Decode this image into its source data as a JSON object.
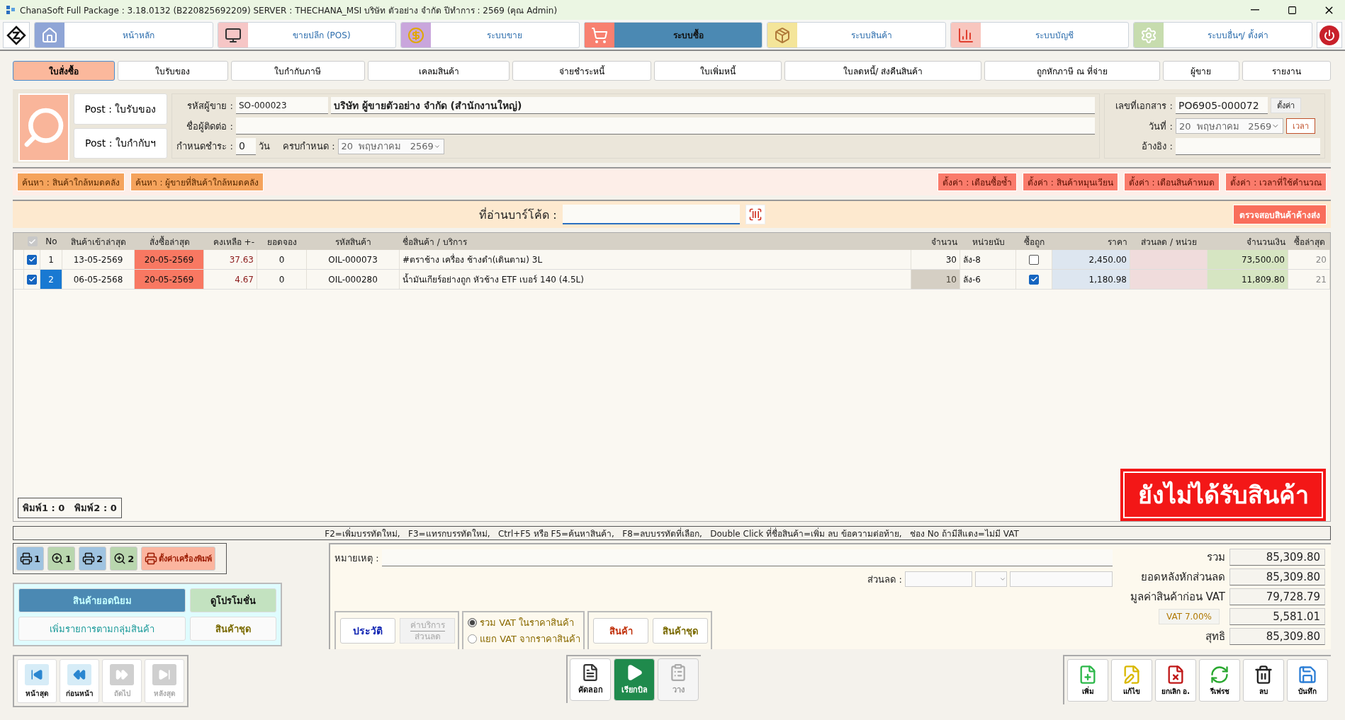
{
  "window": {
    "title": "ChanaSoft Full Package : 3.18.0132 (B220825692209) SERVER : THECHANA_MSI บริษัท ตัวอย่าง จำกัด ปีทำการ : 2569 (คุณ Admin)"
  },
  "modules": [
    {
      "label": "หน้าหลัก",
      "selected": false
    },
    {
      "label": "ขายปลีก (POS)",
      "selected": false
    },
    {
      "label": "ระบบขาย",
      "selected": false
    },
    {
      "label": "ระบบซื้อ",
      "selected": true
    },
    {
      "label": "ระบบสินค้า",
      "selected": false
    },
    {
      "label": "ระบบบัญชี",
      "selected": false
    },
    {
      "label": "ระบบอื่นๆ/ ตั้งค่า",
      "selected": false
    }
  ],
  "doc_tabs": [
    {
      "label": "ใบสั่งซื้อ",
      "selected": true
    },
    {
      "label": "ใบรับของ",
      "selected": false
    },
    {
      "label": "ใบกำกับภาษี",
      "selected": false
    },
    {
      "label": "เคลมสินค้า",
      "selected": false
    },
    {
      "label": "จ่ายชำระหนี้",
      "selected": false
    },
    {
      "label": "ใบเพิ่มหนี้",
      "selected": false
    },
    {
      "label": "ใบลดหนี้/ ส่งคืนสินค้า",
      "selected": false
    },
    {
      "label": "ถูกหักภาษี ณ ที่จ่าย",
      "selected": false
    },
    {
      "label": "ผู้ขาย",
      "selected": false
    },
    {
      "label": "รายงาน",
      "selected": false
    }
  ],
  "post_buttons": [
    "Post : ใบรับของ",
    "Post : ใบกำกับฯ"
  ],
  "supplier": {
    "code_label": "รหัสผู้ขาย :",
    "code": "SO-000023",
    "name": "บริษัท ผู้ขายตัวอย่าง จำกัด (สำนักงานใหญ่)",
    "contact_label": "ชื่อผู้ติดต่อ :",
    "terms_label": "กำหนดชำระ :",
    "terms": "0",
    "terms_unit": "วัน",
    "due_label": "ครบกำหนด :",
    "due_date": "20  พฤษภาคม   2569"
  },
  "document": {
    "number_label": "เลขที่เอกสาร :",
    "number": "PO6905-000072",
    "setting_button": "ตั้งค่า",
    "date_label": "วันที่ :",
    "date": "20  พฤษภาคม   2569",
    "time_button": "เวลา",
    "reference_label": "อ้างอิง :"
  },
  "search_buttons": [
    "ค้นหา : สินค้าใกล้หมดคลัง",
    "ค้นหา : ผู้ขายที่สินค้าใกล้หมดคลัง"
  ],
  "setting_buttons": [
    "ตั้งค่า : เตือนซื้อซ้ำ",
    "ตั้งค่า : สินค้าหมุนเวียน",
    "ตั้งค่า : เตือนสินค้าหมด",
    "ตั้งค่า : เวลาที่ใช้คำนวณ"
  ],
  "barcode": {
    "label": "ที่อ่านบาร์โค้ด :",
    "check_button": "ตรวจสอบสินค้าค้างส่ง"
  },
  "table": {
    "header_checked": true,
    "columns": [
      "No",
      "สินค้าเข้าล่าสุด",
      "สั่งซื้อล่าสุด",
      "คงเหลือ +-",
      "ยอดจอง",
      "รหัสสินค้า",
      "ชื่อสินค้า / บริการ",
      "จำนวน",
      "หน่วยนับ",
      "ซื้อถูก",
      "ราคา",
      "ส่วนลด / หน่วย",
      "จำนวนเงิน",
      "ซื้อล่าสุด"
    ],
    "rows": [
      {
        "checked": true,
        "selected": false,
        "no": "1",
        "last_in": "13-05-2569",
        "last_order": "20-05-2569",
        "balance": "37.63",
        "reserved": "0",
        "code": "OIL-000073",
        "name": "#ตราช้าง เครื่อง ช้างดำ(เดินตาม) 3L",
        "qty": "30",
        "unit": "ลัง-8",
        "cheap": false,
        "price": "2,450.00",
        "amount": "73,500.00",
        "last_buy": "20"
      },
      {
        "checked": true,
        "selected": true,
        "no": "2",
        "last_in": "06-05-2568",
        "last_order": "20-05-2569",
        "balance": "4.67",
        "reserved": "0",
        "code": "OIL-000280",
        "name": "น้ำมันเกียร์อย่างถูก หัวช้าง ETF เบอร์ 140 (4.5L)",
        "qty": "10",
        "unit": "ลัง-6",
        "cheap": true,
        "price": "1,180.98",
        "amount": "11,809.80",
        "last_buy": "21"
      }
    ]
  },
  "print_counter": [
    "พิมพ์1 : 0",
    "พิมพ์2 : 0"
  ],
  "status_stamp": "ยังไม่ได้รับสินค้า",
  "hint": "F2=เพิ่มบรรทัดใหม่,   F3=แทรกบรรทัดใหม่,   Ctrl+F5 หรือ F5=ค้นหาสินค้า,   F8=ลบบรรทัดที่เลือก,   Double Click ที่ชื่อสินค้า=เพิ่ม ลบ ข้อความต่อท้าย,   ช่อง No ถ้ามีสีแดง=ไม่มี VAT",
  "print_buttons": [
    {
      "kind": "print",
      "label": "1"
    },
    {
      "kind": "preview",
      "label": "1"
    },
    {
      "kind": "print",
      "label": "2"
    },
    {
      "kind": "preview",
      "label": "2"
    },
    {
      "kind": "setup",
      "label": "ตั้งค่าเครื่องพิมพ์"
    }
  ],
  "product_panel": [
    {
      "label": "สินค้ายอดนิยม",
      "selected": true
    },
    {
      "label": "ดูโปรโมชั่น",
      "selected": false
    },
    {
      "label": "เพิ่มรายการตามกลุ่มสินค้า",
      "selected": false
    },
    {
      "label": "สินค้าชุด",
      "selected": false
    }
  ],
  "navigation": [
    {
      "label": "หน้าสุด",
      "disabled": false
    },
    {
      "label": "ก่อนหน้า",
      "disabled": false
    },
    {
      "label": "ถัดไป",
      "disabled": true
    },
    {
      "label": "หลังสุด",
      "disabled": true
    }
  ],
  "note": {
    "label": "หมายเหตุ :",
    "discount_label": "ส่วนลด :"
  },
  "history_button": "ประวัติ",
  "service_button": {
    "lines": [
      "ค่าบริการ",
      "ส่วนลด"
    ],
    "disabled": true
  },
  "vat_options": [
    {
      "label": "รวม VAT ในราคาสินค้า",
      "selected": true
    },
    {
      "label": "แยก VAT จากราคาสินค้า",
      "selected": false
    }
  ],
  "item_buttons": [
    "สินค้า",
    "สินค้าชุด"
  ],
  "totals": [
    {
      "kind": "plain",
      "label": "รวม",
      "value": "85,309.80"
    },
    {
      "kind": "plain",
      "label": "ยอดหลังหักส่วนลด",
      "value": "85,309.80"
    },
    {
      "kind": "plain",
      "label": "มูลค่าสินค้าก่อน VAT",
      "value": "79,728.79"
    },
    {
      "kind": "vat",
      "label": "VAT 7.00%",
      "value": "5,581.01"
    },
    {
      "kind": "plain",
      "label": "สุทธิ",
      "value": "85,309.80"
    }
  ],
  "bill_buttons": [
    {
      "kind": "copy",
      "label": "คัดลอก",
      "disabled": false
    },
    {
      "kind": "call",
      "label": "เรียกบิล",
      "disabled": false
    },
    {
      "kind": "paste",
      "label": "วาง",
      "disabled": true
    }
  ],
  "actions": [
    "เพิ่ม",
    "แก้ไข",
    "ยกเลิก อ.",
    "รีเฟรช",
    "ลบ",
    "บันทึก"
  ]
}
